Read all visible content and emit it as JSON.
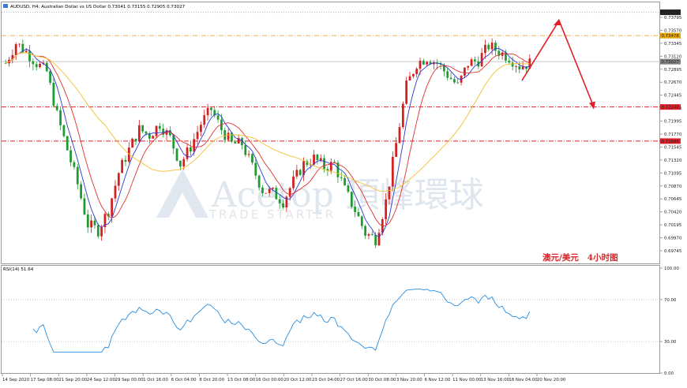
{
  "chart_data": {
    "type": "candlestick",
    "symbol": "AUDUSD",
    "header_text": "AUDUSD, H4: Australian Dollar vs US Dollar 0.73041 0.73155 0.72905 0.73027",
    "annotation_label": "澳元/美元   4小时图",
    "watermark": {
      "main": "Acetop 頂峰環球",
      "sub": "TRADE STARTER"
    },
    "price_axis": {
      "min": 0.6952,
      "max": 0.7392,
      "ticks": [
        "0.73795",
        "0.73570",
        "0.73345",
        "0.73120",
        "0.72895",
        "0.72670",
        "0.72445",
        "0.72220",
        "0.71995",
        "0.71770",
        "0.71545",
        "0.71320",
        "0.71095",
        "0.70870",
        "0.70645",
        "0.70420",
        "0.70195",
        "0.69970",
        "0.69745"
      ],
      "tick_values": [
        0.73795,
        0.7357,
        0.73345,
        0.7312,
        0.72895,
        0.7267,
        0.72445,
        0.7222,
        0.71995,
        0.7177,
        0.71545,
        0.7132,
        0.71095,
        0.7087,
        0.70645,
        0.7042,
        0.70195,
        0.6997,
        0.69745
      ],
      "price_tags": [
        {
          "text": "0.73883",
          "value": 0.73883,
          "color": "#222222"
        },
        {
          "text": "0.73478",
          "value": 0.73478,
          "color": "#e6a800"
        },
        {
          "text": "0.73027",
          "value": 0.73027,
          "color": "#808080"
        },
        {
          "text": "0.72240",
          "value": 0.7224,
          "color": "#e0202a"
        },
        {
          "text": "0.71648",
          "value": 0.71648,
          "color": "#e0202a"
        }
      ]
    },
    "horizontal_lines": [
      {
        "value": 0.73883,
        "color": "#b0b0b0",
        "style": "dotted"
      },
      {
        "value": 0.73478,
        "color": "#e8b54a",
        "style": "dashdot"
      },
      {
        "value": 0.73027,
        "color": "#c8c8c8",
        "style": "solid"
      },
      {
        "value": 0.7224,
        "color": "#e0202a",
        "style": "dashdot"
      },
      {
        "value": 0.71648,
        "color": "#e0202a",
        "style": "dashdot"
      }
    ],
    "x_labels": [
      "14 Sep 2020",
      "17 Sep 08:00",
      "21 Sep 20:00",
      "24 Sep 12:00",
      "29 Sep 00:00",
      "1 Oct 16:00",
      "6 Oct 04:00",
      "8 Oct 20:00",
      "13 Oct 08:00",
      "16 Oct 00:00",
      "20 Oct 12:00",
      "23 Oct 04:00",
      "27 Oct 16:00",
      "30 Oct 08:00",
      "3 Nov 20:00",
      "6 Nov 12:00",
      "11 Nov 00:00",
      "13 Nov 16:00",
      "18 Nov 04:00",
      "20 Nov 20:00"
    ],
    "price_path": [
      [
        0,
        0.73
      ],
      [
        3,
        0.7335
      ],
      [
        6,
        0.732
      ],
      [
        9,
        0.73
      ],
      [
        12,
        0.7285
      ],
      [
        15,
        0.721
      ],
      [
        18,
        0.715
      ],
      [
        21,
        0.709
      ],
      [
        24,
        0.702
      ],
      [
        27,
        0.701
      ],
      [
        30,
        0.7045
      ],
      [
        33,
        0.711
      ],
      [
        36,
        0.715
      ],
      [
        39,
        0.7185
      ],
      [
        42,
        0.7175
      ],
      [
        45,
        0.7195
      ],
      [
        48,
        0.717
      ],
      [
        51,
        0.7125
      ],
      [
        54,
        0.7155
      ],
      [
        57,
        0.7195
      ],
      [
        60,
        0.722
      ],
      [
        63,
        0.7185
      ],
      [
        66,
        0.716
      ],
      [
        69,
        0.716
      ],
      [
        72,
        0.712
      ],
      [
        75,
        0.708
      ],
      [
        78,
        0.7075
      ],
      [
        81,
        0.706
      ],
      [
        84,
        0.7095
      ],
      [
        87,
        0.7125
      ],
      [
        90,
        0.7135
      ],
      [
        93,
        0.712
      ],
      [
        96,
        0.7125
      ],
      [
        99,
        0.708
      ],
      [
        102,
        0.7045
      ],
      [
        105,
        0.7005
      ],
      [
        108,
        0.6995
      ],
      [
        111,
        0.706
      ],
      [
        114,
        0.716
      ],
      [
        117,
        0.726
      ],
      [
        120,
        0.73
      ],
      [
        123,
        0.731
      ],
      [
        126,
        0.73
      ],
      [
        129,
        0.728
      ],
      [
        132,
        0.726
      ],
      [
        135,
        0.73
      ],
      [
        138,
        0.7305
      ],
      [
        141,
        0.733
      ],
      [
        144,
        0.732
      ],
      [
        147,
        0.731
      ],
      [
        150,
        0.7295
      ],
      [
        153,
        0.73
      ]
    ],
    "candle_count": 154,
    "moving_averages": [
      {
        "period": 5,
        "color": "#2a3ad0"
      },
      {
        "period": 10,
        "color": "#e03030"
      },
      {
        "period": 30,
        "color": "#f2c030"
      }
    ],
    "forecast_arrow": {
      "points": [
        [
          0.727,
          0
        ],
        [
          0.7374,
          1
        ],
        [
          0.7224,
          2
        ]
      ],
      "color": "#e0202a"
    },
    "rsi": {
      "label": "RSI(14) 51.64",
      "last_value": 51.64,
      "ticks": [
        "100.00",
        "70.00",
        "30.00",
        "0.00"
      ],
      "tick_values": [
        100,
        70,
        30,
        0
      ],
      "levels": [
        70,
        30
      ],
      "color": "#2b8fe0"
    }
  }
}
